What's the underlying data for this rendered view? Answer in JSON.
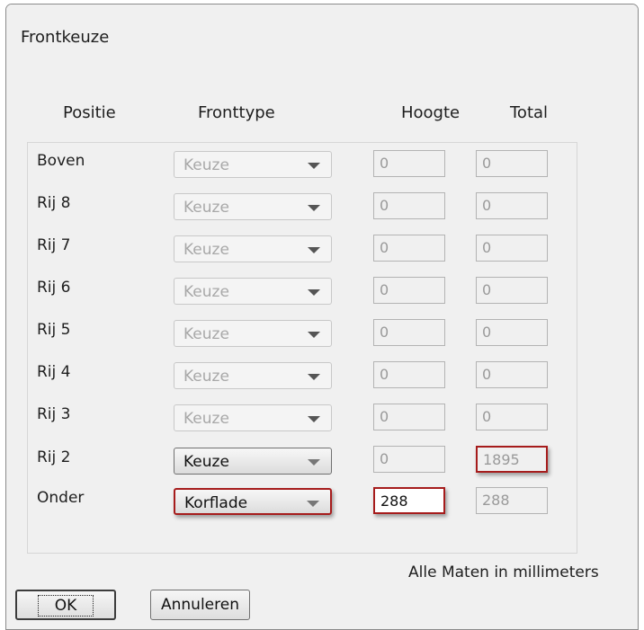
{
  "window": {
    "title": "Frontkeuze"
  },
  "headers": {
    "positie": "Positie",
    "fronttype": "Fronttype",
    "hoogte": "Hoogte",
    "total": "Total"
  },
  "rows": [
    {
      "label": "Boven",
      "fronttype": "Keuze",
      "hoogte": "0",
      "total": "0"
    },
    {
      "label": "Rij 8",
      "fronttype": "Keuze",
      "hoogte": "0",
      "total": "0"
    },
    {
      "label": "Rij 7",
      "fronttype": "Keuze",
      "hoogte": "0",
      "total": "0"
    },
    {
      "label": "Rij 6",
      "fronttype": "Keuze",
      "hoogte": "0",
      "total": "0"
    },
    {
      "label": "Rij 5",
      "fronttype": "Keuze",
      "hoogte": "0",
      "total": "0"
    },
    {
      "label": "Rij 4",
      "fronttype": "Keuze",
      "hoogte": "0",
      "total": "0"
    },
    {
      "label": "Rij 3",
      "fronttype": "Keuze",
      "hoogte": "0",
      "total": "0"
    },
    {
      "label": "Rij 2",
      "fronttype": "Keuze",
      "hoogte": "0",
      "total": "1895"
    },
    {
      "label": "Onder",
      "fronttype": "Korflade",
      "hoogte": "288",
      "total": "288"
    }
  ],
  "note": "Alle Maten in millimeters",
  "buttons": {
    "ok": "OK",
    "cancel": "Annuleren"
  },
  "colors": {
    "highlight": "#a61c1c",
    "window_bg": "#f0f0f0"
  }
}
